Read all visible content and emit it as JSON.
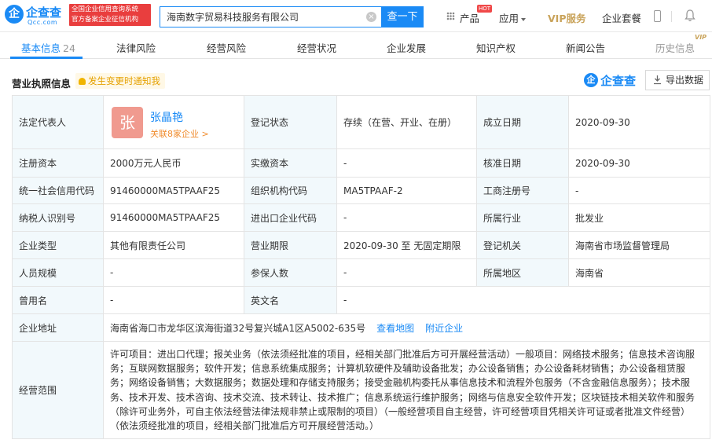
{
  "header": {
    "logo_mark": "企",
    "logo_name": "企查查",
    "logo_domain": "Qcc.com",
    "badge_line1": "全国企业信用查询系统",
    "badge_line2": "官方备案企业征信机构",
    "search_value": "海南数字贸易科技服务有限公司",
    "search_button": "查一下",
    "nav_product": "产品",
    "hot_label": "HOT",
    "nav_app": "应用",
    "nav_vip": "VIP服务",
    "nav_package": "企业套餐"
  },
  "tabs": {
    "basic": "基本信息",
    "basic_count": "24",
    "legal_risk": "法律风险",
    "operating_risk": "经营风险",
    "operating_status": "经营状况",
    "development": "企业发展",
    "ip": "知识产权",
    "news": "新闻公告",
    "history": "历史信息",
    "vip_corner": "VIP"
  },
  "section": {
    "title": "营业执照信息",
    "notify": "发生变更时通知我",
    "qcc_logo_mark": "企",
    "qcc_logo_text": "企查查",
    "export": "导出数据"
  },
  "rep": {
    "label": "法定代表人",
    "avatar": "张",
    "name": "张晶艳",
    "link": "关联8家企业 >"
  },
  "rows": {
    "reg_status_label": "登记状态",
    "reg_status": "存续（在营、开业、在册）",
    "est_date_label": "成立日期",
    "est_date": "2020-09-30",
    "reg_capital_label": "注册资本",
    "reg_capital": "2000万元人民币",
    "paid_capital_label": "实缴资本",
    "paid_capital": "-",
    "approve_date_label": "核准日期",
    "approve_date": "2020-09-30",
    "credit_code_label": "统一社会信用代码",
    "credit_code": "91460000MA5TPAAF25",
    "org_code_label": "组织机构代码",
    "org_code": "MA5TPAAF-2",
    "biz_reg_label": "工商注册号",
    "biz_reg": "-",
    "taxpayer_label": "纳税人识别号",
    "taxpayer": "91460000MA5TPAAF25",
    "import_export_label": "进出口企业代码",
    "import_export": "-",
    "industry_label": "所属行业",
    "industry": "批发业",
    "type_label": "企业类型",
    "type": "其他有限责任公司",
    "term_label": "营业期限",
    "term": "2020-09-30 至 无固定期限",
    "authority_label": "登记机关",
    "authority": "海南省市场监督管理局",
    "staff_label": "人员规模",
    "staff": "-",
    "insured_label": "参保人数",
    "insured": "-",
    "region_label": "所属地区",
    "region": "海南省",
    "former_name_label": "曾用名",
    "former_name": "-",
    "en_name_label": "英文名",
    "en_name": "-",
    "address_label": "企业地址",
    "address": "海南省海口市龙华区滨海街道32号复兴城A1区A5002-635号",
    "view_map": "查看地图",
    "nearby": "附近企业",
    "scope_label": "经营范围",
    "scope": "许可项目：进出口代理；报关业务（依法须经批准的项目，经相关部门批准后方可开展经营活动）一般项目：网络技术服务；信息技术咨询服务；互联网数据服务；软件开发；信息系统集成服务；计算机软硬件及辅助设备批发；办公设备销售；办公设备耗材销售；办公设备租赁服务；网络设备销售；大数据服务；数据处理和存储支持服务；接受金融机构委托从事信息技术和流程外包服务（不含金融信息服务）；技术服务、技术开发、技术咨询、技术交流、技术转让、技术推广；信息系统运行维护服务；网络与信息安全软件开发；区块链技术相关软件和服务（除许可业务外，可自主依法经营法律法规非禁止或限制的项目）（一般经营项目自主经营，许可经营项目凭相关许可证或者批准文件经营）（依法须经批准的项目，经相关部门批准后方可开展经营活动。）"
  },
  "colors": {
    "brand": "#1a8af5",
    "label_bg": "#f2f9fc",
    "avatar_bg": "#f09a8f",
    "badge_red": "#e93e3e",
    "link_orange": "#f08c2e"
  }
}
